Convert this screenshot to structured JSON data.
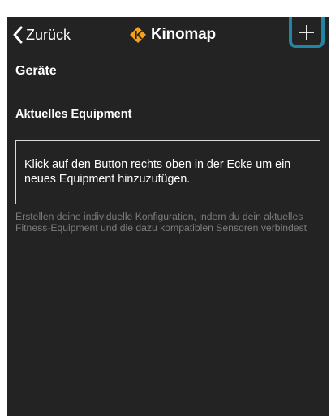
{
  "navbar": {
    "back_label": "Zurück",
    "brand_name": "Kinomap",
    "add_label": "+",
    "highlight_color": "#1f86a3",
    "brand_color": "#f5a11b"
  },
  "page": {
    "title": "Geräte"
  },
  "equipment": {
    "heading": "Aktuelles Equipment",
    "empty_message": "Klick auf den Button rechts oben in der Ecke um ein neues Equipment hinzuzufügen.",
    "hint": "Erstellen deine individuelle Konfiguration, indem du dein aktuelles Fitness-Equipment und die dazu kompatiblen Sensoren verbindest"
  },
  "icons": {
    "back": "chevron-left-icon",
    "logo": "kinomap-logo-icon",
    "add": "plus-icon"
  },
  "colors": {
    "background": "#232323",
    "text": "#ffffff",
    "muted_text": "#7c7c7c"
  }
}
